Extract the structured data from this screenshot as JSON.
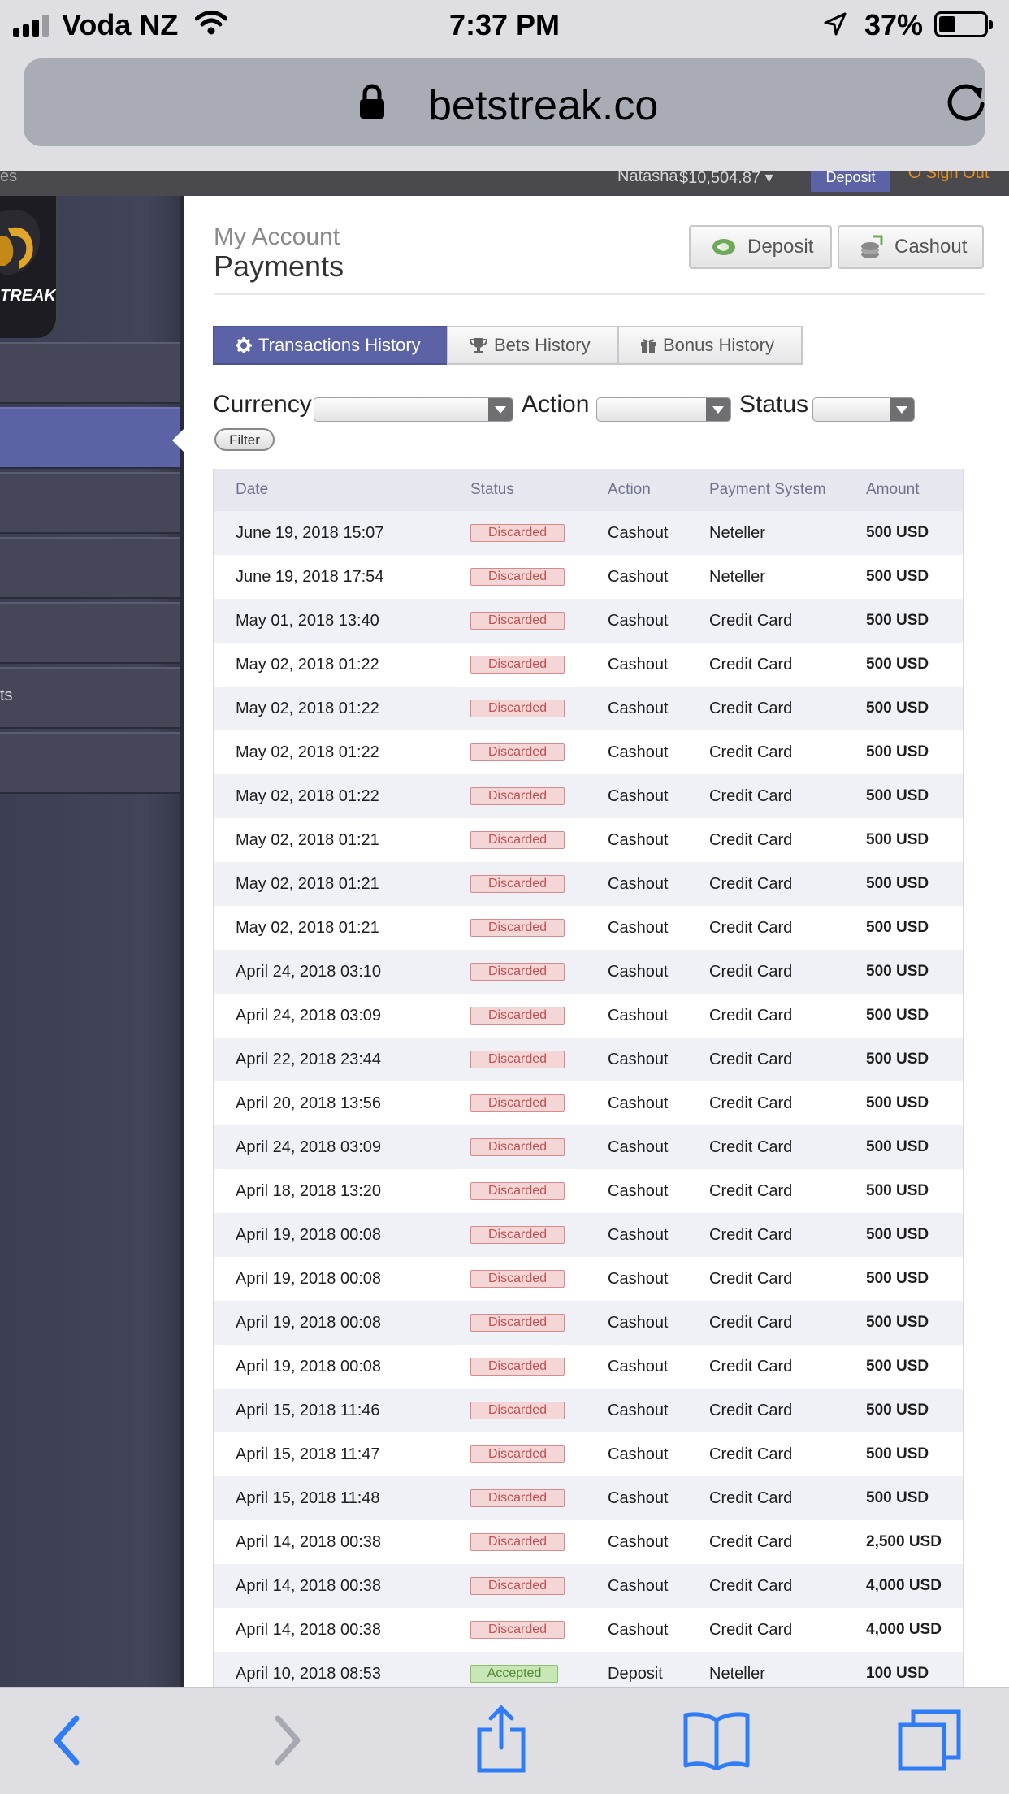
{
  "status_bar": {
    "carrier": "Voda NZ",
    "time": "7:37 PM",
    "battery_percent": "37%",
    "battery_level": 0.37,
    "signal_bars": 3
  },
  "browser": {
    "url": "betstreak.co"
  },
  "site_header": {
    "fragment_left": "es",
    "username": "Natasha",
    "balance": "$10,504.87 ▾",
    "deposit_label": "Deposit",
    "signout_label": "Sign Out"
  },
  "sidebar": {
    "logo_text": "TREAK",
    "items": [
      {
        "label": ""
      },
      {
        "label": ""
      },
      {
        "label": ""
      },
      {
        "label": ""
      },
      {
        "label": ""
      },
      {
        "label": "ts"
      },
      {
        "label": ""
      }
    ],
    "active_index": 1
  },
  "page": {
    "breadcrumb": "My Account",
    "title": "Payments",
    "deposit_button": "Deposit",
    "cashout_button": "Cashout"
  },
  "tabs": [
    {
      "label": "Transactions History",
      "icon": "gear-icon",
      "active": true
    },
    {
      "label": "Bets History",
      "icon": "trophy-icon",
      "active": false
    },
    {
      "label": "Bonus History",
      "icon": "gift-icon",
      "active": false
    }
  ],
  "filters": {
    "currency_label": "Currency",
    "action_label": "Action",
    "status_label": "Status",
    "currency_value": "",
    "action_value": "",
    "status_value": "",
    "filter_button": "Filter"
  },
  "table": {
    "columns": [
      "Date",
      "Status",
      "Action",
      "Payment System",
      "Amount"
    ],
    "rows": [
      [
        "June 19, 2018 15:07",
        "Discarded",
        "Cashout",
        "Neteller",
        "500 USD"
      ],
      [
        "June 19, 2018 17:54",
        "Discarded",
        "Cashout",
        "Neteller",
        "500 USD"
      ],
      [
        "May 01, 2018 13:40",
        "Discarded",
        "Cashout",
        "Credit Card",
        "500 USD"
      ],
      [
        "May 02, 2018 01:22",
        "Discarded",
        "Cashout",
        "Credit Card",
        "500 USD"
      ],
      [
        "May 02, 2018 01:22",
        "Discarded",
        "Cashout",
        "Credit Card",
        "500 USD"
      ],
      [
        "May 02, 2018 01:22",
        "Discarded",
        "Cashout",
        "Credit Card",
        "500 USD"
      ],
      [
        "May 02, 2018 01:22",
        "Discarded",
        "Cashout",
        "Credit Card",
        "500 USD"
      ],
      [
        "May 02, 2018 01:21",
        "Discarded",
        "Cashout",
        "Credit Card",
        "500 USD"
      ],
      [
        "May 02, 2018 01:21",
        "Discarded",
        "Cashout",
        "Credit Card",
        "500 USD"
      ],
      [
        "May 02, 2018 01:21",
        "Discarded",
        "Cashout",
        "Credit Card",
        "500 USD"
      ],
      [
        "April 24, 2018 03:10",
        "Discarded",
        "Cashout",
        "Credit Card",
        "500 USD"
      ],
      [
        "April 24, 2018 03:09",
        "Discarded",
        "Cashout",
        "Credit Card",
        "500 USD"
      ],
      [
        "April 22, 2018 23:44",
        "Discarded",
        "Cashout",
        "Credit Card",
        "500 USD"
      ],
      [
        "April 20, 2018 13:56",
        "Discarded",
        "Cashout",
        "Credit Card",
        "500 USD"
      ],
      [
        "April 24, 2018 03:09",
        "Discarded",
        "Cashout",
        "Credit Card",
        "500 USD"
      ],
      [
        "April 18, 2018 13:20",
        "Discarded",
        "Cashout",
        "Credit Card",
        "500 USD"
      ],
      [
        "April 19, 2018 00:08",
        "Discarded",
        "Cashout",
        "Credit Card",
        "500 USD"
      ],
      [
        "April 19, 2018 00:08",
        "Discarded",
        "Cashout",
        "Credit Card",
        "500 USD"
      ],
      [
        "April 19, 2018 00:08",
        "Discarded",
        "Cashout",
        "Credit Card",
        "500 USD"
      ],
      [
        "April 19, 2018 00:08",
        "Discarded",
        "Cashout",
        "Credit Card",
        "500 USD"
      ],
      [
        "April 15, 2018 11:46",
        "Discarded",
        "Cashout",
        "Credit Card",
        "500 USD"
      ],
      [
        "April 15, 2018 11:47",
        "Discarded",
        "Cashout",
        "Credit Card",
        "500 USD"
      ],
      [
        "April 15, 2018 11:48",
        "Discarded",
        "Cashout",
        "Credit Card",
        "500 USD"
      ],
      [
        "April 14, 2018 00:38",
        "Discarded",
        "Cashout",
        "Credit Card",
        "2,500 USD"
      ],
      [
        "April 14, 2018 00:38",
        "Discarded",
        "Cashout",
        "Credit Card",
        "4,000 USD"
      ],
      [
        "April 14, 2018 00:38",
        "Discarded",
        "Cashout",
        "Credit Card",
        "4,000 USD"
      ],
      [
        "April 10, 2018 08:53",
        "Accepted",
        "Deposit",
        "Neteller",
        "100 USD"
      ]
    ]
  },
  "toolbar": {
    "icons": [
      "back-icon",
      "forward-icon",
      "share-icon",
      "bookmarks-icon",
      "tabs-icon"
    ]
  },
  "colors": {
    "accent": "#5b63a6",
    "sidebar": "#42445a",
    "discarded": "#c45050",
    "accepted": "#4f8a2f",
    "ios_blue": "#2f7cf6"
  }
}
